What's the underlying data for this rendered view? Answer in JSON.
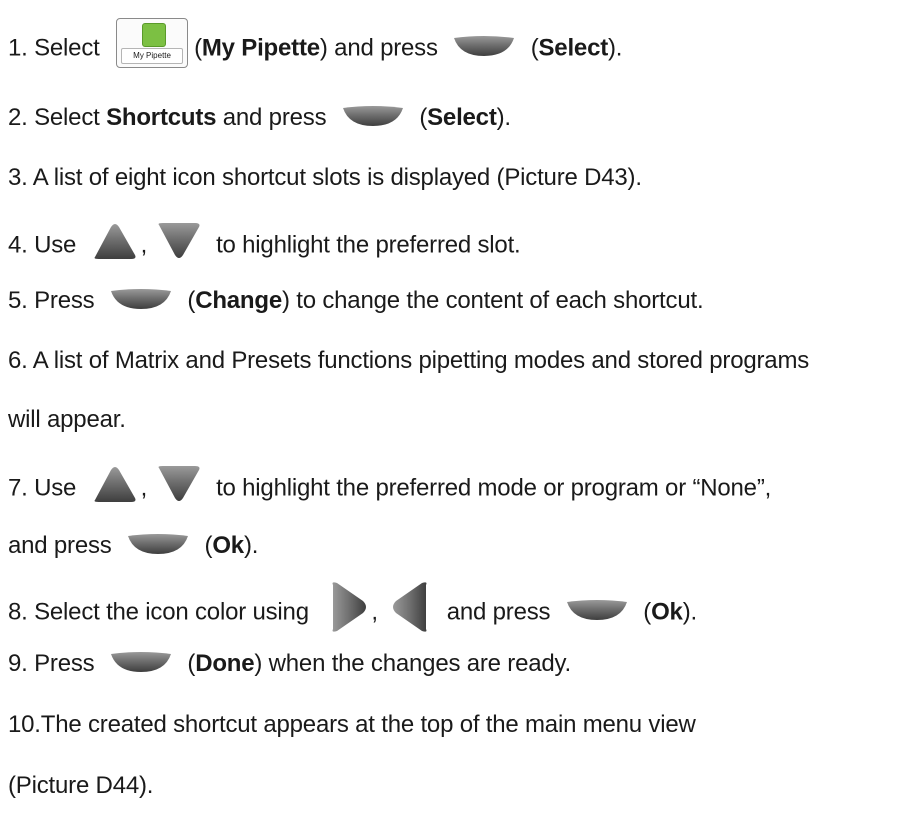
{
  "steps": [
    {
      "num": "1.",
      "t1": "Select",
      "icon_label": "My Pipette",
      "t2": "(",
      "b1": "My Pipette",
      "t3": ") and press",
      "t4": "(",
      "b2": "Select",
      "t5": ")."
    },
    {
      "num": "2.",
      "t1": "Select",
      "b1": "Shortcuts",
      "t2": "and press",
      "t3": "(",
      "b2": "Select",
      "t4": ")."
    },
    {
      "num": "3.",
      "text": "A list of eight icon shortcut slots is displayed (Picture D43)."
    },
    {
      "num": "4.",
      "t1": "Use",
      "sep": ",",
      "t2": "to highlight the preferred slot."
    },
    {
      "num": "5.",
      "t1": "Press",
      "t2": "(",
      "b1": "Change",
      "t3": ") to change the content of each shortcut."
    },
    {
      "num": "6.",
      "text": "A list of Matrix and Presets functions pipetting modes and stored programs",
      "cont": "will appear."
    },
    {
      "num": "7.",
      "t1": "Use",
      "sep": ",",
      "t2": "to highlight the preferred mode or program or “None”,",
      "cont1": "and press",
      "cont2": "(",
      "b1": "Ok",
      "cont3": ")."
    },
    {
      "num": "8.",
      "t1": "Select the icon color using",
      "sep": ",",
      "t2": "and press",
      "t3": "(",
      "b1": "Ok",
      "t4": ")."
    },
    {
      "num": "9.",
      "t1": "Press",
      "t2": "(",
      "b1": "Done",
      "t3": ") when the changes are ready."
    },
    {
      "num": "10.",
      "text": "The created shortcut appears at the top of the main menu view",
      "cont": "(Picture D44)."
    }
  ],
  "icons": {
    "softkey": "softkey-button-icon",
    "up": "up-arrow-key-icon",
    "down": "down-arrow-key-icon",
    "right": "right-arrow-key-icon",
    "left": "left-arrow-key-icon",
    "app": "my-pipette-app-icon"
  },
  "colors": {
    "key": "#6b6b6b",
    "app_green": "#7cc043"
  }
}
